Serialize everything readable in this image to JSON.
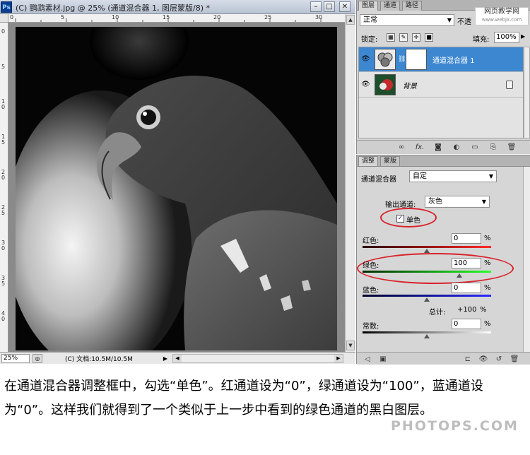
{
  "document": {
    "app_badge": "Ps",
    "title": "(C) 鹦鹉素材.jpg @ 25% (通道混合器 1, 图层蒙版/8) *",
    "zoom": "25%",
    "doc_info": "(C) 文档:10.5M/10.5M",
    "ruler_top_labels": [
      "0",
      "5",
      "10",
      "15",
      "20",
      "25",
      "30"
    ],
    "ruler_left_labels": [
      "0",
      "5",
      "1 0",
      "1 5",
      "2 0",
      "2 5",
      "3 0",
      "3 5",
      "4 0"
    ]
  },
  "layers_panel": {
    "tabs": [
      "图层",
      "通道",
      "路径"
    ],
    "blend_mode": "正常",
    "opacity_label": "不透",
    "lock_label": "锁定:",
    "fill_label": "填充:",
    "fill_value": "100%",
    "layers": [
      {
        "name": "通道混合器 1",
        "selected": true
      },
      {
        "name": "背景",
        "selected": false
      }
    ],
    "footer_icons": [
      "link-icon",
      "fx-icon",
      "mask-icon",
      "adjustment-icon",
      "group-icon",
      "new-layer-icon",
      "trash-icon"
    ]
  },
  "watermark_site": {
    "line1": "网页教学网",
    "line2": "www.webjx.com"
  },
  "adjustments_panel": {
    "tabs": [
      "调整",
      "蒙版"
    ],
    "title": "通道混合器",
    "preset": "自定",
    "output_label": "输出通道:",
    "output_value": "灰色",
    "monochrome_label": "单色",
    "monochrome_checked": true,
    "channels": [
      {
        "label": "红色:",
        "value": "0",
        "pct": "%",
        "level": 0
      },
      {
        "label": "绿色:",
        "value": "100",
        "pct": "%",
        "level": 100
      },
      {
        "label": "蓝色:",
        "value": "0",
        "pct": "%",
        "level": 0
      }
    ],
    "total_label": "总计:",
    "total_value": "+100",
    "total_pct": "%",
    "constant_label": "常数:",
    "constant_value": "0",
    "constant_pct": "%",
    "constant_level": 0
  },
  "caption": {
    "text": "在通道混合器调整框中，勾选“单色”。红通道设为“0”，绿通道设为“100”，蓝通道设为“0”。这样我们就得到了一个类似于上一步中看到的绿色通道的黑白图层。",
    "watermark": "PHOTOPS.COM"
  },
  "colors": {
    "selection": "#3d87d1",
    "highlight_ring": "#d9222a",
    "panel": "#d6d6d6"
  }
}
